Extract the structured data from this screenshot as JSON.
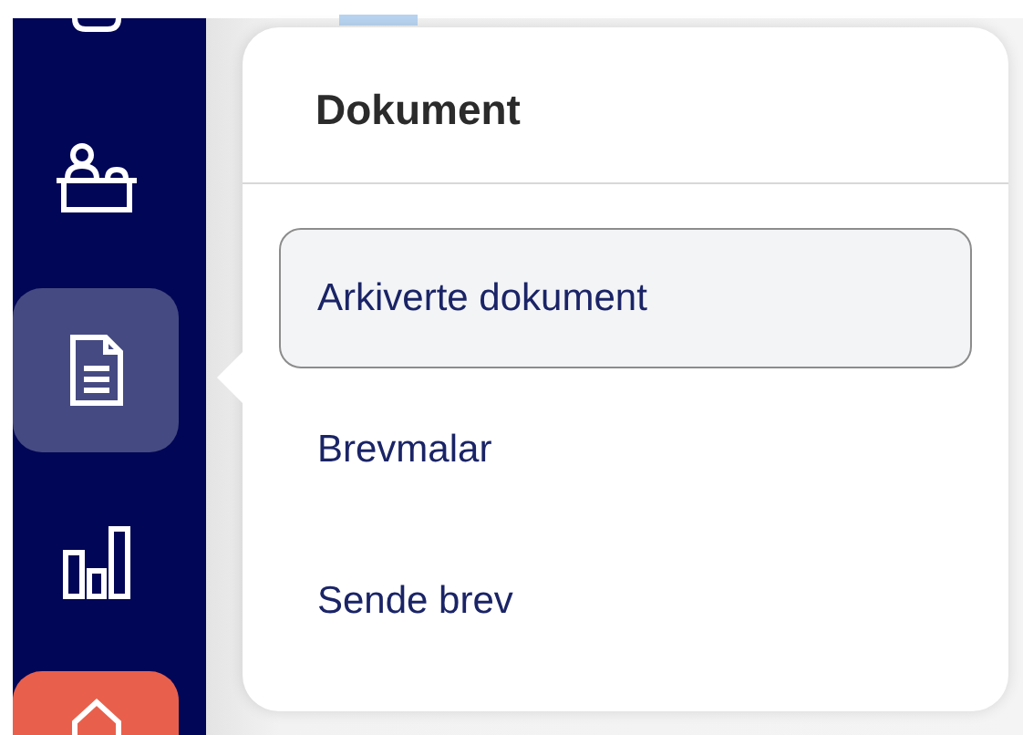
{
  "sidebar": {
    "items": [
      {
        "kind": "badge",
        "selected": false
      },
      {
        "kind": "reception",
        "selected": false
      },
      {
        "kind": "document",
        "selected": true
      },
      {
        "kind": "chart",
        "selected": false
      },
      {
        "kind": "home",
        "selected": false
      }
    ]
  },
  "menu": {
    "title": "Dokument",
    "items": [
      {
        "label": "Arkiverte dokument",
        "selected": true
      },
      {
        "label": "Brevmalar",
        "selected": false
      },
      {
        "label": "Sende brev",
        "selected": false
      }
    ]
  }
}
